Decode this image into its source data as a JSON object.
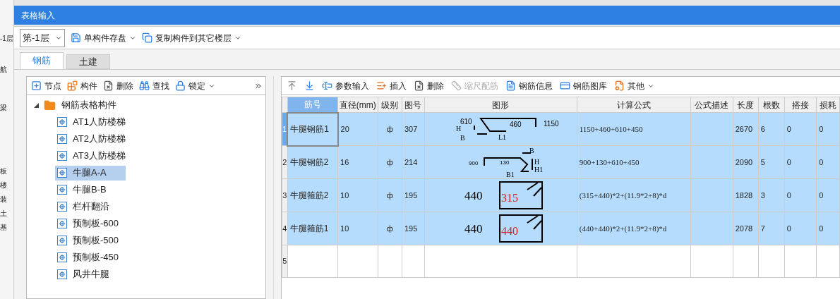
{
  "background_app": {
    "side_labels": [
      "-1层",
      "航",
      "梁",
      "板",
      "楼",
      "装",
      "土",
      "基"
    ]
  },
  "window": {
    "title": "表格输入"
  },
  "toolbar": {
    "floor_select": {
      "value": "第-1层"
    },
    "items": [
      {
        "label": "单构件存盘",
        "kind": "dropdown"
      },
      {
        "label": "复制构件到其它楼层",
        "kind": "dropdown"
      }
    ]
  },
  "tabs": [
    {
      "label": "钢筋",
      "selected": true
    },
    {
      "label": "土建",
      "selected": false
    }
  ],
  "tree_toolbar": [
    {
      "label": "节点",
      "kind": "button"
    },
    {
      "label": "构件",
      "kind": "button"
    },
    {
      "label": "删除",
      "kind": "button"
    },
    {
      "label": "查找",
      "kind": "button"
    },
    {
      "label": "锁定",
      "kind": "dropdown"
    },
    {
      "kind": "more"
    }
  ],
  "tree": {
    "label": "钢筋表格构件",
    "expanded": true,
    "children": [
      {
        "label": "AT1人防楼梯",
        "selected": false
      },
      {
        "label": "AT2人防楼梯",
        "selected": false
      },
      {
        "label": "AT3人防楼梯",
        "selected": false
      },
      {
        "label": "牛腿A-A",
        "selected": true
      },
      {
        "label": "牛腿B-B",
        "selected": false
      },
      {
        "label": "栏杆翻沿",
        "selected": false
      },
      {
        "label": "预制板-600",
        "selected": false
      },
      {
        "label": "预制板-500",
        "selected": false
      },
      {
        "label": "预制板-450",
        "selected": false
      },
      {
        "label": "风井牛腿",
        "selected": false
      }
    ]
  },
  "grid_toolbar": [
    {
      "kind": "icon",
      "disabled": false
    },
    {
      "kind": "icon",
      "disabled": false
    },
    {
      "label": "参数输入",
      "kind": "button",
      "disabled": false
    },
    {
      "label": "插入",
      "kind": "button",
      "disabled": false
    },
    {
      "label": "删除",
      "kind": "button",
      "disabled": false
    },
    {
      "label": "缩尺配筋",
      "kind": "button",
      "disabled": true
    },
    {
      "label": "钢筋信息",
      "kind": "button",
      "disabled": false
    },
    {
      "label": "钢筋图库",
      "kind": "button",
      "disabled": false
    },
    {
      "label": "其他",
      "kind": "dropdown",
      "disabled": false
    }
  ],
  "table": {
    "columns": [
      "筋号",
      "直径(mm)",
      "级别",
      "图号",
      "图形",
      "计算公式",
      "公式描述",
      "长度",
      "根数",
      "搭接",
      "损耗"
    ],
    "rows": [
      {
        "index": "1",
        "selected": true,
        "current": true,
        "cells": [
          "牛腿钢筋1",
          "20",
          "ф",
          "307",
          "",
          "1150+460+610+450",
          "",
          "2670",
          "6",
          "0",
          "0"
        ],
        "figure": {
          "kind": "hook-up",
          "labels": [
            "610",
            "460",
            "1150",
            "H",
            "B",
            "L1"
          ]
        }
      },
      {
        "index": "2",
        "selected": true,
        "current": false,
        "cells": [
          "牛腿钢筋2",
          "16",
          "ф",
          "214",
          "",
          "900+130+610+450",
          "",
          "2090",
          "5",
          "0",
          "0"
        ],
        "figure": {
          "kind": "hook-down",
          "labels": [
            "900",
            "130",
            "B",
            "H",
            "H1",
            "B1"
          ]
        }
      },
      {
        "index": "3",
        "selected": true,
        "current": false,
        "cells": [
          "牛腿箍筋2",
          "10",
          "ф",
          "195",
          "",
          "(315+440)*2+(11.9*2+8)*d",
          "",
          "1828",
          "3",
          "0",
          "0"
        ],
        "figure": {
          "kind": "stirrup",
          "labels": [
            "440",
            "315"
          ]
        }
      },
      {
        "index": "4",
        "selected": true,
        "current": false,
        "cells": [
          "牛腿箍筋1",
          "10",
          "ф",
          "195",
          "",
          "(440+440)*2+(11.9*2+8)*d",
          "",
          "2078",
          "7",
          "0",
          "0"
        ],
        "figure": {
          "kind": "stirrup",
          "labels": [
            "440",
            "440"
          ]
        }
      },
      {
        "index": "5",
        "selected": false,
        "current": false,
        "cells": [
          "",
          "",
          "",
          "",
          "",
          "",
          "",
          "",
          "",
          "",
          ""
        ]
      }
    ]
  }
}
